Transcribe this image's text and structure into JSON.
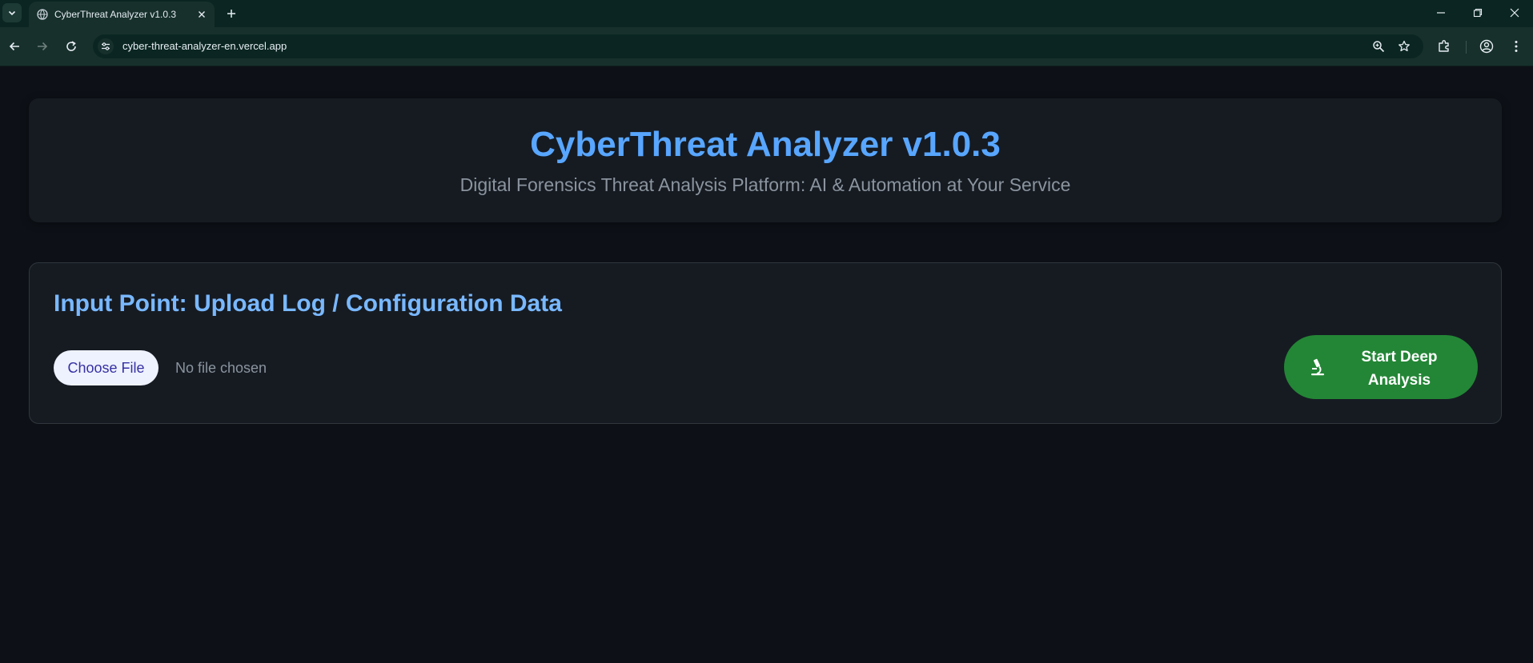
{
  "browser": {
    "tab_title": "CyberThreat Analyzer v1.0.3",
    "url": "cyber-threat-analyzer-en.vercel.app"
  },
  "header": {
    "title": "CyberThreat Analyzer v1.0.3",
    "subtitle": "Digital Forensics Threat Analysis Platform: AI & Automation at Your Service"
  },
  "upload": {
    "section_title": "Input Point: Upload Log / Configuration Data",
    "choose_file_label": "Choose File",
    "file_status": "No file chosen",
    "start_button_label": "Start Deep Analysis",
    "start_button_icon": "microscope-icon"
  },
  "colors": {
    "accent": "#58a6ff",
    "primary_button": "#238636",
    "background": "#0d1117",
    "card": "#161b22"
  }
}
